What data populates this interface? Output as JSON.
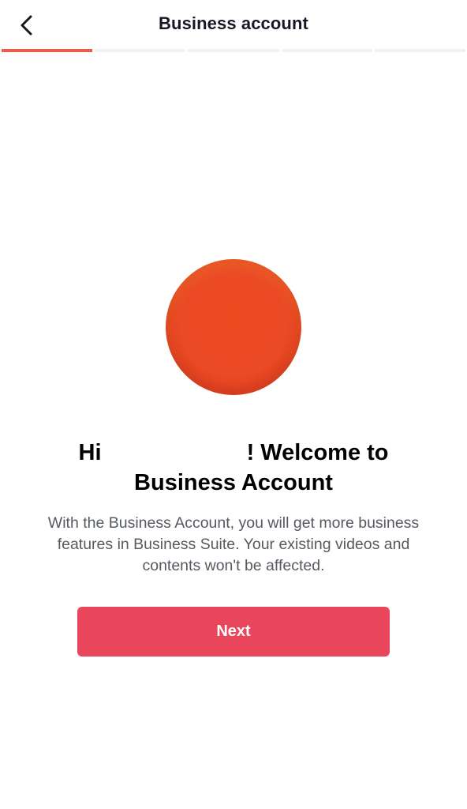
{
  "header": {
    "title": "Business account",
    "back_icon": "chevron-left-icon"
  },
  "progress": {
    "total_steps": 5,
    "current_step": 1,
    "active_color": "#ec5c46",
    "inactive_color": "#f1f1f2"
  },
  "avatar": {
    "color": "#ea4a24"
  },
  "welcome": {
    "greeting": "Hi",
    "suffix": "! Welcome to Business Account"
  },
  "description": "With the Business Account, you will get more business features in Business Suite. Your existing videos and contents won't be affected.",
  "next_button": {
    "label": "Next",
    "color": "#e9465b"
  }
}
